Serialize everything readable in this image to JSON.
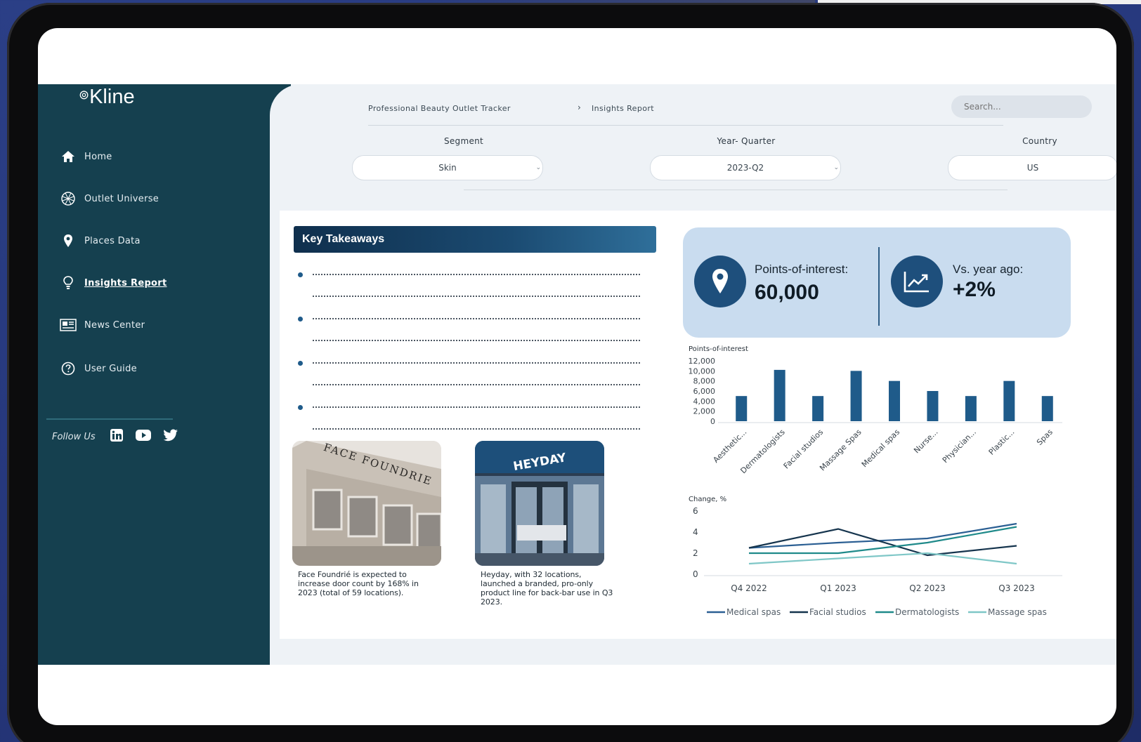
{
  "app": {
    "logo": "Kline"
  },
  "sidebar": {
    "items": [
      {
        "label": "Home",
        "icon": "home-icon",
        "active": false
      },
      {
        "label": "Outlet Universe",
        "icon": "globe-network-icon",
        "active": false
      },
      {
        "label": "Places Data",
        "icon": "map-pin-icon",
        "active": false
      },
      {
        "label": "Insights Report",
        "icon": "lightbulb-icon",
        "active": true
      },
      {
        "label": "News Center",
        "icon": "newspaper-icon",
        "active": false
      },
      {
        "label": "User Guide",
        "icon": "help-circle-icon",
        "active": false
      }
    ],
    "follow_label": "Follow Us",
    "social": [
      "linkedin-icon",
      "youtube-icon",
      "twitter-icon"
    ]
  },
  "header": {
    "breadcrumb_root": "Professional Beauty Outlet Tracker",
    "breadcrumb_current": "Insights Report",
    "search_placeholder": "Search..."
  },
  "filters": {
    "segment": {
      "label": "Segment",
      "value": "Skin"
    },
    "year_quarter": {
      "label": "Year- Quarter",
      "value": "2023-Q2"
    },
    "country": {
      "label": "Country",
      "value": "US"
    }
  },
  "takeaways": {
    "title": "Key Takeaways"
  },
  "photos": [
    {
      "sign": "FACE FOUNDRIE",
      "caption": "Face Foundrié is expected to increase door count by 168% in 2023 (total of 59 locations)."
    },
    {
      "sign": "HEYDAY",
      "caption": "Heyday, with 32 locations, launched a branded, pro-only product line for back-bar use in Q3 2023."
    }
  ],
  "kpis": [
    {
      "label": "Points-of-interest:",
      "value": "60,000",
      "icon": "map-pin-icon"
    },
    {
      "label": "Vs. year ago:",
      "value": "+2%",
      "icon": "trend-chart-icon"
    }
  ],
  "colors": {
    "sidebar": "#15404f",
    "accent": "#1f5b8a",
    "kpi_bg": "#c9dcef"
  },
  "chart_data": [
    {
      "type": "bar",
      "ylabel": "Points-of-interest",
      "ylim": [
        0,
        12000
      ],
      "yticks": [
        "12,000",
        "10,000",
        "8,000",
        "6,000",
        "4,000",
        "2,000",
        "0"
      ],
      "yticks_values": [
        12000,
        10000,
        8000,
        6000,
        4000,
        2000,
        0
      ],
      "categories": [
        "Aesthetic...",
        "Dermatologists",
        "Facial studios",
        "Massage Spas",
        "Medical spas",
        "Nurse...",
        "Physician...",
        "Plastic...",
        "Spas"
      ],
      "values": [
        5000,
        10200,
        5000,
        10000,
        8000,
        6000,
        5000,
        8000,
        5000
      ],
      "color": "#1f5b8a"
    },
    {
      "type": "line",
      "ylabel": "Change, %",
      "ylim": [
        0,
        6
      ],
      "yticks": [
        "6",
        "4",
        "2",
        "0"
      ],
      "yticks_values": [
        6,
        4,
        2,
        0
      ],
      "x": [
        "Q4 2022",
        "Q1 2023",
        "Q2 2023",
        "Q3 2023"
      ],
      "series": [
        {
          "name": "Medical spas",
          "values": [
            2.5,
            3.0,
            3.4,
            4.8
          ],
          "color": "#2b5f93"
        },
        {
          "name": "Facial studios",
          "values": [
            2.5,
            4.3,
            1.8,
            2.7
          ],
          "color": "#15344d"
        },
        {
          "name": "Dermatologists",
          "values": [
            2.0,
            2.0,
            3.0,
            4.5
          ],
          "color": "#1f8a8a"
        },
        {
          "name": "Massage spas",
          "values": [
            1.0,
            1.5,
            2.0,
            1.0
          ],
          "color": "#7fc7c7"
        }
      ]
    }
  ]
}
